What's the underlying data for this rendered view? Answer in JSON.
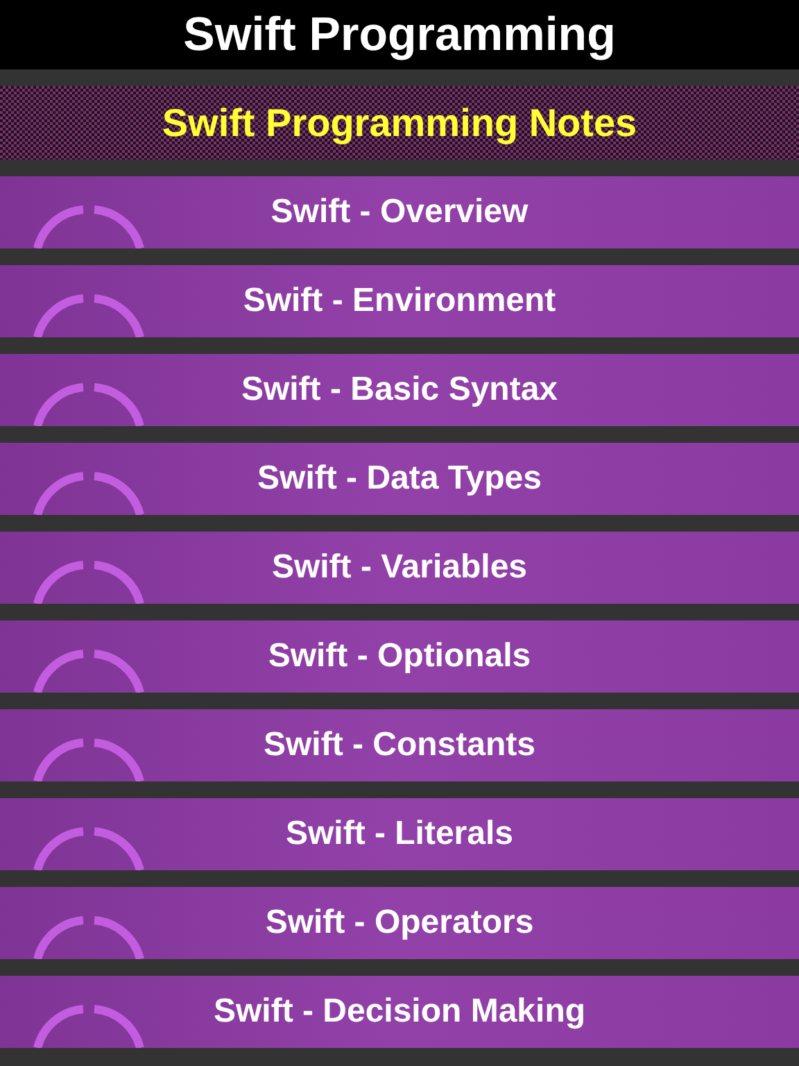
{
  "header": {
    "title": "Swift Programming"
  },
  "subheader": {
    "title": "Swift Programming Notes"
  },
  "menu": [
    {
      "label": "Swift - Overview"
    },
    {
      "label": "Swift - Environment"
    },
    {
      "label": "Swift - Basic Syntax"
    },
    {
      "label": "Swift - Data Types"
    },
    {
      "label": "Swift - Variables"
    },
    {
      "label": "Swift - Optionals"
    },
    {
      "label": "Swift - Constants"
    },
    {
      "label": "Swift - Literals"
    },
    {
      "label": "Swift - Operators"
    },
    {
      "label": "Swift - Decision Making"
    }
  ]
}
